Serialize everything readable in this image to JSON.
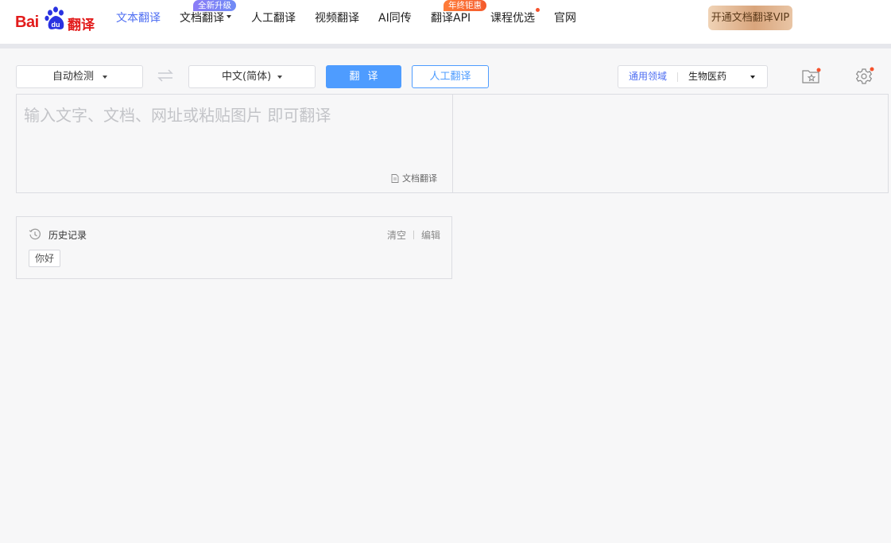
{
  "brand": {
    "logo_text": "Bai du 翻译"
  },
  "nav": {
    "items": [
      {
        "label": "文本翻译",
        "active": true
      },
      {
        "label": "文档翻译",
        "dropdown": true,
        "badge": "全新升级"
      },
      {
        "label": "人工翻译"
      },
      {
        "label": "视频翻译"
      },
      {
        "label": "AI同传"
      },
      {
        "label": "翻译API",
        "badge": "年终钜惠"
      },
      {
        "label": "课程优选",
        "dot": true
      },
      {
        "label": "官网"
      }
    ],
    "vip_label": "开通文档翻译VIP"
  },
  "toolbar": {
    "source_lang": "自动检测",
    "target_lang": "中文(简体)",
    "translate_label": "翻译",
    "human_translate_label": "人工翻译",
    "domain_label": "通用领域",
    "domain_value": "生物医药"
  },
  "input": {
    "placeholder": "输入文字、文档、网址或粘贴图片 即可翻译",
    "value": "",
    "doc_link_label": "文档翻译"
  },
  "history": {
    "title": "历史记录",
    "clear_label": "清空",
    "edit_label": "编辑",
    "items": [
      "你好"
    ]
  },
  "colors": {
    "brand_red": "#e21b1b",
    "accent_blue": "#4e9cff",
    "nav_active": "#4e6ef2",
    "dot_red": "#f5522d"
  }
}
